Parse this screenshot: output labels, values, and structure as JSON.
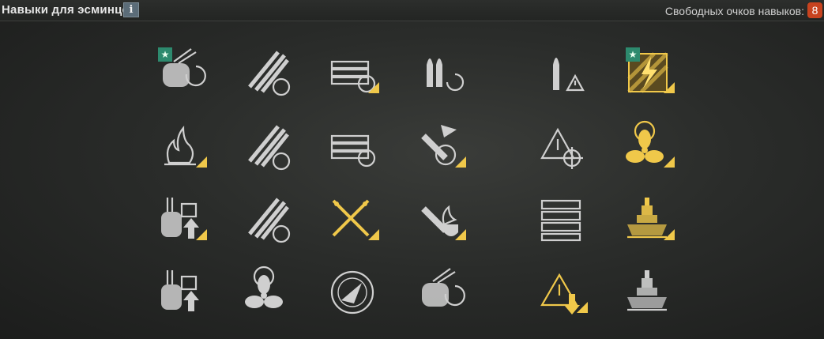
{
  "header": {
    "title": "Навыки для эсминцев",
    "info_label": "i",
    "free_points_label": "Свободных очков навыков:",
    "free_points_value": "8"
  },
  "colors": {
    "gray_icon": "#cfcfcf",
    "yellow_icon": "#f0c84a",
    "badge_green": "#2d8a6e",
    "points_badge": "#c8431f"
  },
  "badge_glyph": "★",
  "skills": [
    {
      "id": "gun-rotation-speed-icon",
      "tier": 1,
      "column": 1,
      "color": "gray",
      "starred": true,
      "corner": false
    },
    {
      "id": "torpedo-armament-icon",
      "tier": 1,
      "column": 2,
      "color": "gray",
      "starred": false,
      "corner": false
    },
    {
      "id": "reload-consumables-icon",
      "tier": 1,
      "column": 3,
      "color": "gray",
      "starred": false,
      "corner": true
    },
    {
      "id": "shells-reload-icon",
      "tier": 1,
      "column": 4,
      "color": "gray",
      "starred": false,
      "corner": false
    },
    {
      "id": "shell-warning-icon",
      "tier": 1,
      "column": 5,
      "color": "gray",
      "starred": false,
      "corner": false
    },
    {
      "id": "last-stand-icon",
      "tier": 1,
      "column": 6,
      "color": "yellow",
      "starred": true,
      "corner": true
    },
    {
      "id": "fire-icon",
      "tier": 2,
      "column": 1,
      "color": "gray",
      "starred": false,
      "corner": true
    },
    {
      "id": "torpedo-speed-icon",
      "tier": 2,
      "column": 2,
      "color": "gray",
      "starred": false,
      "corner": false
    },
    {
      "id": "consumable-timer-icon",
      "tier": 2,
      "column": 3,
      "color": "gray",
      "starred": false,
      "corner": false
    },
    {
      "id": "hull-flag-icon",
      "tier": 2,
      "column": 4,
      "color": "gray",
      "starred": false,
      "corner": true
    },
    {
      "id": "target-warning-icon",
      "tier": 2,
      "column": 5,
      "color": "gray",
      "starred": false,
      "corner": false
    },
    {
      "id": "propulsion-steering-icon",
      "tier": 2,
      "column": 6,
      "color": "yellow",
      "starred": false,
      "corner": true
    },
    {
      "id": "secondary-armament-upgrade-icon",
      "tier": 3,
      "column": 1,
      "color": "gray",
      "starred": false,
      "corner": true
    },
    {
      "id": "torpedo-reload-icon",
      "tier": 3,
      "column": 2,
      "color": "gray",
      "starred": false,
      "corner": false
    },
    {
      "id": "crossed-torpedoes-icon",
      "tier": 3,
      "column": 3,
      "color": "yellow",
      "starred": false,
      "corner": true
    },
    {
      "id": "fire-shield-icon",
      "tier": 3,
      "column": 4,
      "color": "gray",
      "starred": false,
      "corner": true
    },
    {
      "id": "consumable-count-icon",
      "tier": 3,
      "column": 5,
      "color": "gray",
      "starred": false,
      "corner": false
    },
    {
      "id": "survivability-ship-icon",
      "tier": 3,
      "column": 6,
      "color": "yellow",
      "starred": false,
      "corner": true
    },
    {
      "id": "secondary-range-upgrade-icon",
      "tier": 4,
      "column": 1,
      "color": "gray",
      "starred": false,
      "corner": false
    },
    {
      "id": "engine-boost-icon",
      "tier": 4,
      "column": 2,
      "color": "gray",
      "starred": false,
      "corner": false
    },
    {
      "id": "radar-icon",
      "tier": 4,
      "column": 3,
      "color": "gray",
      "starred": false,
      "corner": false
    },
    {
      "id": "main-battery-reload-icon",
      "tier": 4,
      "column": 4,
      "color": "gray",
      "starred": false,
      "corner": false
    },
    {
      "id": "detection-warning-icon",
      "tier": 4,
      "column": 5,
      "color": "yellow",
      "starred": false,
      "corner": true
    },
    {
      "id": "concealment-ship-icon",
      "tier": 4,
      "column": 6,
      "color": "gray",
      "starred": false,
      "corner": false
    }
  ]
}
